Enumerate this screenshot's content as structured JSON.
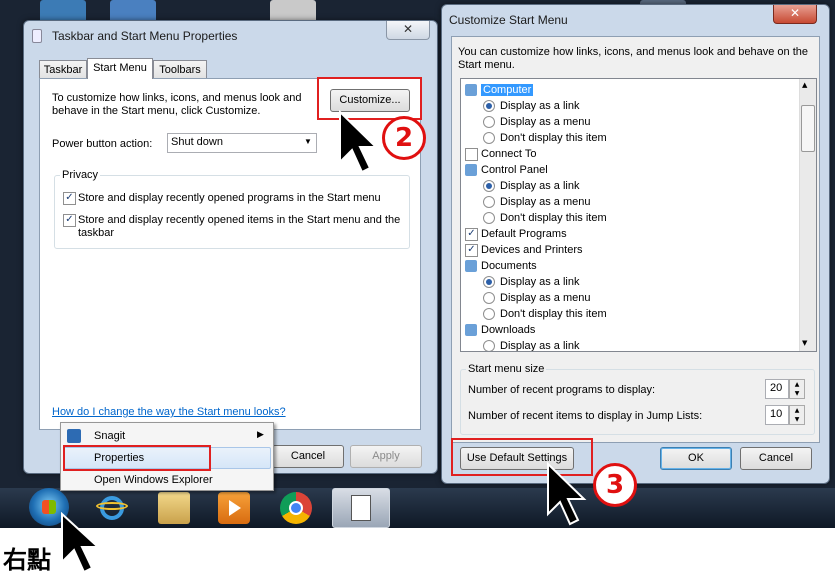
{
  "taskbar_props": {
    "title": "Taskbar and Start Menu Properties",
    "close": "✕",
    "tabs": [
      "Taskbar",
      "Start Menu",
      "Toolbars"
    ],
    "intro_line1": "To customize how links, icons, and menus look and",
    "intro_line2": "behave in the Start menu, click Customize.",
    "customize_label": "Customize...",
    "power_label": "Power button action:",
    "power_value": "Shut down",
    "privacy_label": "Privacy",
    "privacy_items": [
      "Store and display recently opened programs in the Start menu",
      "Store and display recently opened items in the Start menu and the",
      "taskbar"
    ],
    "help_link": "How do I change the way the Start menu looks?",
    "cancel_label": "Cancel",
    "apply_label": "Apply"
  },
  "context_menu": {
    "items": [
      "Snagit",
      "Properties",
      "Open Windows Explorer"
    ]
  },
  "customize_window": {
    "title": "Customize Start Menu",
    "close": "✕",
    "intro_line1": "You can customize how links, icons, and menus look and behave on the",
    "intro_line2": "Start menu.",
    "list": [
      {
        "kind": "header",
        "label": "Computer",
        "selected": true
      },
      {
        "kind": "radio",
        "label": "Display as a link",
        "checked": true
      },
      {
        "kind": "radio",
        "label": "Display as a menu",
        "checked": false
      },
      {
        "kind": "radio",
        "label": "Don't display this item",
        "checked": false
      },
      {
        "kind": "check",
        "label": "Connect To",
        "checked": false
      },
      {
        "kind": "header",
        "label": "Control Panel",
        "selected": false
      },
      {
        "kind": "radio",
        "label": "Display as a link",
        "checked": true
      },
      {
        "kind": "radio",
        "label": "Display as a menu",
        "checked": false
      },
      {
        "kind": "radio",
        "label": "Don't display this item",
        "checked": false
      },
      {
        "kind": "check",
        "label": "Default Programs",
        "checked": true
      },
      {
        "kind": "check",
        "label": "Devices and Printers",
        "checked": true
      },
      {
        "kind": "header",
        "label": "Documents",
        "selected": false
      },
      {
        "kind": "radio",
        "label": "Display as a link",
        "checked": true
      },
      {
        "kind": "radio",
        "label": "Display as a menu",
        "checked": false
      },
      {
        "kind": "radio",
        "label": "Don't display this item",
        "checked": false
      },
      {
        "kind": "header",
        "label": "Downloads",
        "selected": false
      },
      {
        "kind": "radio",
        "label": "Display as a link",
        "checked": false
      }
    ],
    "size_group_label": "Start menu size",
    "recent_programs_label": "Number of recent programs to display:",
    "recent_programs_value": "20",
    "recent_items_label": "Number of recent items to display in Jump Lists:",
    "recent_items_value": "10",
    "default_label": "Use Default Settings",
    "ok_label": "OK",
    "cancel_label": "Cancel"
  },
  "annotations": {
    "step2": "2",
    "step3": "3",
    "right_click": "右點"
  },
  "colors": {
    "accent_red": "#e01010",
    "selection_blue": "#3399ff",
    "link_blue": "#0066cc"
  }
}
